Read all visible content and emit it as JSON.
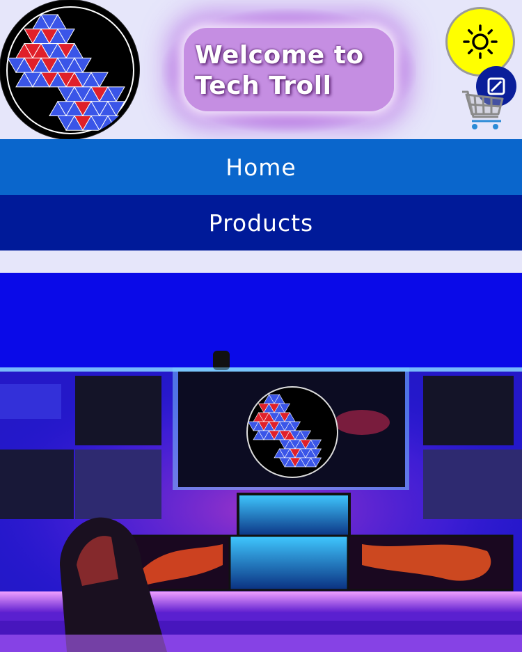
{
  "header": {
    "title_line1": "Welcome to",
    "title_line2": "Tech Troll",
    "logo_icon": "tech-troll-logo",
    "theme_toggle_icon": "sun-icon",
    "contrast_toggle_icon": "contrast-icon",
    "cart_icon": "shopping-cart-icon"
  },
  "nav": {
    "items": [
      {
        "label": "Home"
      },
      {
        "label": "Products"
      }
    ]
  },
  "colors": {
    "background": "#e6e6fa",
    "nav_home": "#0a66cc",
    "nav_products": "#001a99",
    "title_box": "#c58ee2",
    "sun_button": "#ffff00",
    "contrast_button": "#0a1e9a"
  },
  "hero": {
    "image": "gaming-desk-setup-with-tech-troll-logo"
  }
}
